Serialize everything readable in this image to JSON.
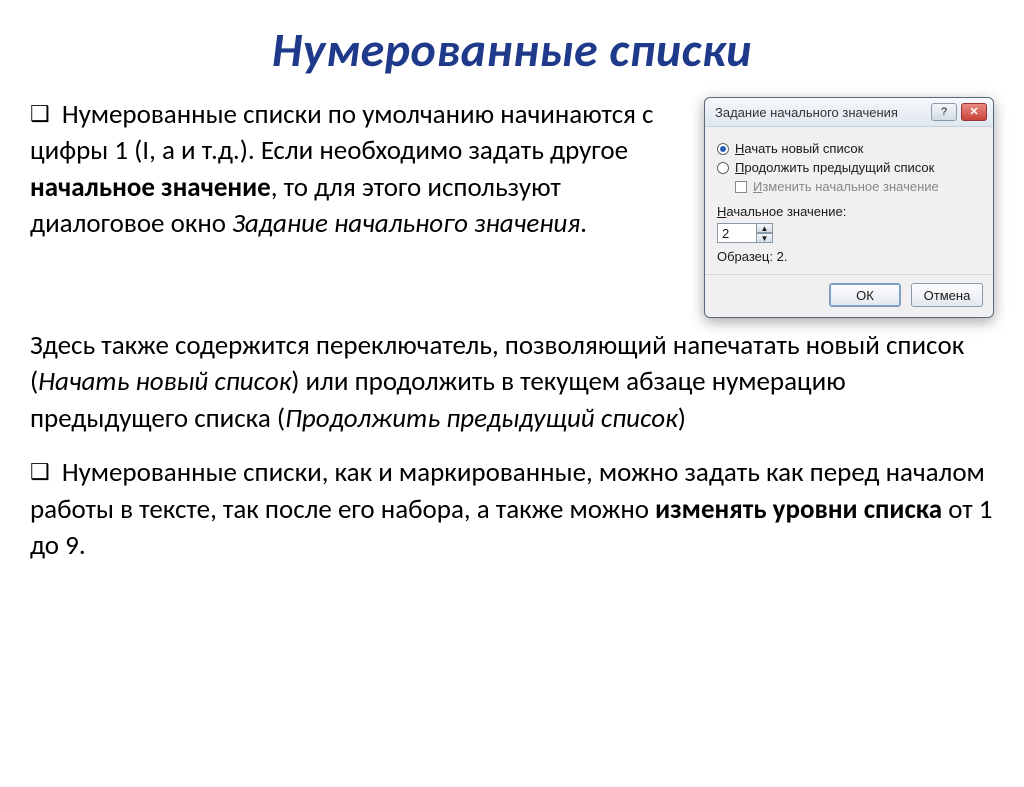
{
  "title": "Нумерованные списки",
  "para1": {
    "prefix": "Нумерованные списки по умолчанию начинаются с цифры 1 (I, а и т.д.). Если необходимо задать другое ",
    "bold1": "начальное значение",
    "mid": ", то для этого используют диалоговое окно ",
    "italic1": "Задание начального значения",
    "suffix": "."
  },
  "para2": {
    "prefix": "Здесь  также содержится переключатель, позволяющий напечатать новый список (",
    "italic1": "Начать новый список",
    "mid": ") или продолжить в текущем абзаце нумерацию предыдущего списка (",
    "italic2": "Продолжить предыдущий список",
    "suffix": ")"
  },
  "para3": {
    "prefix": "Нумерованные списки, как и маркированные, можно задать как перед началом работы в тексте, так после его набора, а также можно ",
    "bold1": "изменять уровни списка",
    "suffix": " от 1 до 9."
  },
  "dialog": {
    "title": "Задание начального значения",
    "help_glyph": "?",
    "close_glyph": "✕",
    "radio1_u": "Н",
    "radio1_rest": "ачать новый список",
    "radio2_u": "П",
    "radio2_rest": "родолжить предыдущий список",
    "check_u": "И",
    "check_rest": "зменить начальное значение",
    "start_label_prefix": "Н",
    "start_label_rest": "ачальное значение:",
    "start_value": "2",
    "spin_up": "▲",
    "spin_down": "▼",
    "sample": "Образец: 2.",
    "ok": "ОК",
    "cancel": "Отмена"
  }
}
